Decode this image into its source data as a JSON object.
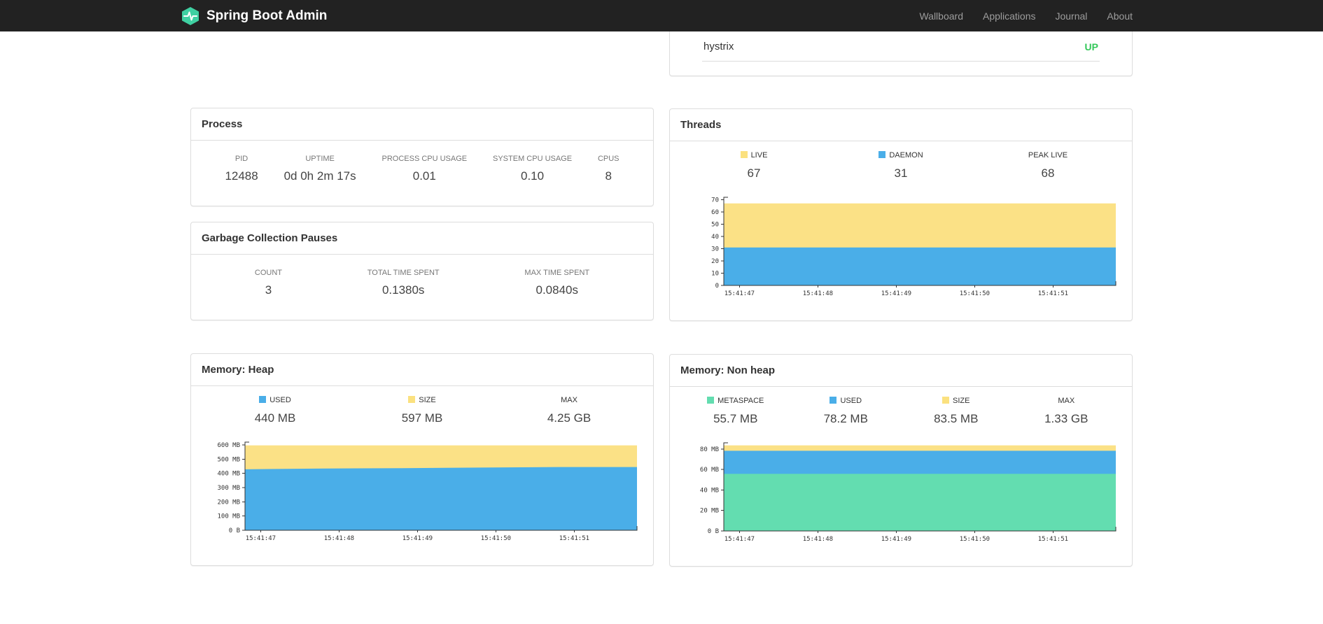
{
  "navbar": {
    "brand": "Spring Boot Admin",
    "brand_color": "#3fd0a2",
    "items": [
      {
        "label": "Wallboard"
      },
      {
        "label": "Applications"
      },
      {
        "label": "Journal"
      },
      {
        "label": "About"
      }
    ]
  },
  "application_row": {
    "name": "hystrix",
    "status": "UP",
    "status_color": "#34c85a"
  },
  "panels": {
    "process": {
      "title": "Process",
      "metrics": [
        {
          "label": "PID",
          "value": "12488"
        },
        {
          "label": "UPTIME",
          "value": "0d 0h 2m 17s"
        },
        {
          "label": "PROCESS CPU USAGE",
          "value": "0.01"
        },
        {
          "label": "SYSTEM CPU USAGE",
          "value": "0.10"
        },
        {
          "label": "CPUS",
          "value": "8"
        }
      ]
    },
    "gc": {
      "title": "Garbage Collection Pauses",
      "metrics": [
        {
          "label": "COUNT",
          "value": "3"
        },
        {
          "label": "TOTAL TIME SPENT",
          "value": "0.1380s"
        },
        {
          "label": "MAX TIME SPENT",
          "value": "0.0840s"
        }
      ]
    },
    "threads": {
      "title": "Threads",
      "stats": [
        {
          "label": "LIVE",
          "swatch": "#fbe17f",
          "value": "67"
        },
        {
          "label": "DAEMON",
          "swatch": "#4aaee8",
          "value": "31"
        },
        {
          "label": "PEAK LIVE",
          "value": "68"
        }
      ]
    },
    "heap": {
      "title": "Memory: Heap",
      "stats": [
        {
          "label": "USED",
          "swatch": "#4aaee8",
          "value": "440 MB"
        },
        {
          "label": "SIZE",
          "swatch": "#fbe17f",
          "value": "597 MB"
        },
        {
          "label": "MAX",
          "value": "4.25 GB"
        }
      ]
    },
    "nonheap": {
      "title": "Memory: Non heap",
      "stats": [
        {
          "label": "METASPACE",
          "swatch": "#63ddb0",
          "value": "55.7 MB"
        },
        {
          "label": "USED",
          "swatch": "#4aaee8",
          "value": "78.2 MB"
        },
        {
          "label": "SIZE",
          "swatch": "#fbe17f",
          "value": "83.5 MB"
        },
        {
          "label": "MAX",
          "value": "1.33 GB"
        }
      ]
    }
  },
  "chart_data": [
    {
      "id": "threads",
      "type": "area",
      "title": "Threads",
      "x": [
        "15:41:47",
        "15:41:48",
        "15:41:49",
        "15:41:50",
        "15:41:51"
      ],
      "ymax": 72,
      "yticks": [
        {
          "v": 0,
          "label": "0"
        },
        {
          "v": 10,
          "label": "10"
        },
        {
          "v": 20,
          "label": "20"
        },
        {
          "v": 30,
          "label": "30"
        },
        {
          "v": 40,
          "label": "40"
        },
        {
          "v": 50,
          "label": "50"
        },
        {
          "v": 60,
          "label": "60"
        },
        {
          "v": 70,
          "label": "70"
        }
      ],
      "series": [
        {
          "name": "LIVE",
          "color": "#fbe186",
          "values": [
            67,
            67,
            67,
            67,
            67
          ]
        },
        {
          "name": "DAEMON",
          "color": "#4aaee8",
          "values": [
            31,
            31,
            31,
            31,
            31
          ]
        }
      ],
      "grid": false,
      "legend_position": "top"
    },
    {
      "id": "heap",
      "type": "area",
      "title": "Memory: Heap",
      "x": [
        "15:41:47",
        "15:41:48",
        "15:41:49",
        "15:41:50",
        "15:41:51"
      ],
      "ymax": 620,
      "yticks": [
        {
          "v": 0,
          "label": "0 B"
        },
        {
          "v": 100,
          "label": "100 MB"
        },
        {
          "v": 200,
          "label": "200 MB"
        },
        {
          "v": 300,
          "label": "300 MB"
        },
        {
          "v": 400,
          "label": "400 MB"
        },
        {
          "v": 500,
          "label": "500 MB"
        },
        {
          "v": 600,
          "label": "600 MB"
        }
      ],
      "series": [
        {
          "name": "SIZE",
          "color": "#fbe186",
          "values": [
            597,
            597,
            597,
            597,
            597
          ]
        },
        {
          "name": "USED",
          "color": "#4aaee8",
          "values": [
            429,
            434,
            437,
            441,
            445
          ]
        }
      ],
      "grid": false,
      "legend_position": "top"
    },
    {
      "id": "nonheap",
      "type": "area",
      "title": "Memory: Non heap",
      "x": [
        "15:41:47",
        "15:41:48",
        "15:41:49",
        "15:41:50",
        "15:41:51"
      ],
      "ymax": 86,
      "yticks": [
        {
          "v": 0,
          "label": "0 B"
        },
        {
          "v": 20,
          "label": "20 MB"
        },
        {
          "v": 40,
          "label": "40 MB"
        },
        {
          "v": 60,
          "label": "60 MB"
        },
        {
          "v": 80,
          "label": "80 MB"
        }
      ],
      "series": [
        {
          "name": "SIZE",
          "color": "#fbe186",
          "values": [
            83.5,
            83.5,
            83.5,
            83.5,
            83.5
          ]
        },
        {
          "name": "USED",
          "color": "#4aaee8",
          "values": [
            78.2,
            78.2,
            78.2,
            78.2,
            78.2
          ]
        },
        {
          "name": "METASPACE",
          "color": "#63ddb0",
          "values": [
            55.7,
            55.7,
            55.7,
            55.7,
            55.7
          ]
        }
      ],
      "grid": false,
      "legend_position": "top"
    }
  ]
}
